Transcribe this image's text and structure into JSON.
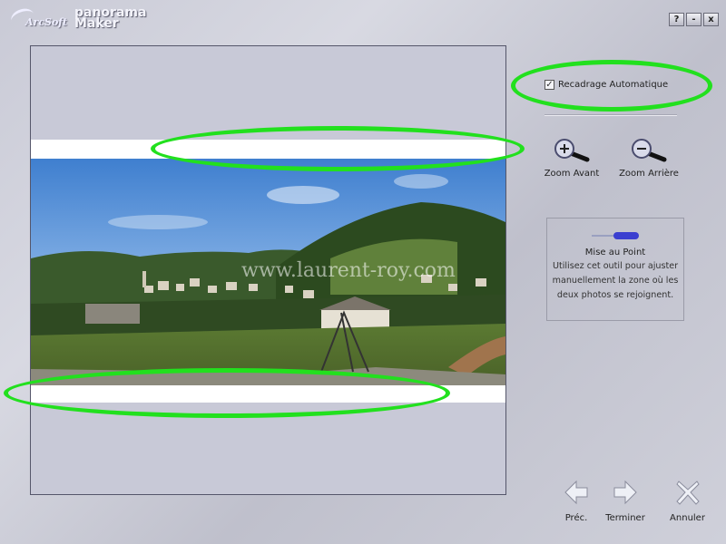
{
  "app": {
    "logo_brand": "ArcSoft",
    "logo_product_line1": "panorama",
    "logo_product_line2": "Maker"
  },
  "window_controls": {
    "help": "?",
    "minimize": "-",
    "close": "x"
  },
  "preview": {
    "watermark": "www.laurent-roy.com"
  },
  "right_panel": {
    "auto_crop_label": "Recadrage Automatique",
    "auto_crop_checked": true,
    "zoom_in_label": "Zoom Avant",
    "zoom_out_label": "Zoom Arrière",
    "focus_tool": {
      "title": "Mise au Point",
      "description": "Utilisez cet outil pour ajuster manuellement la zone où les deux photos se rejoignent."
    }
  },
  "nav": {
    "prev_label": "Préc.",
    "finish_label": "Terminer",
    "cancel_label": "Annuler"
  },
  "colors": {
    "annotation": "#22e01e",
    "background": "#cfd0da"
  }
}
